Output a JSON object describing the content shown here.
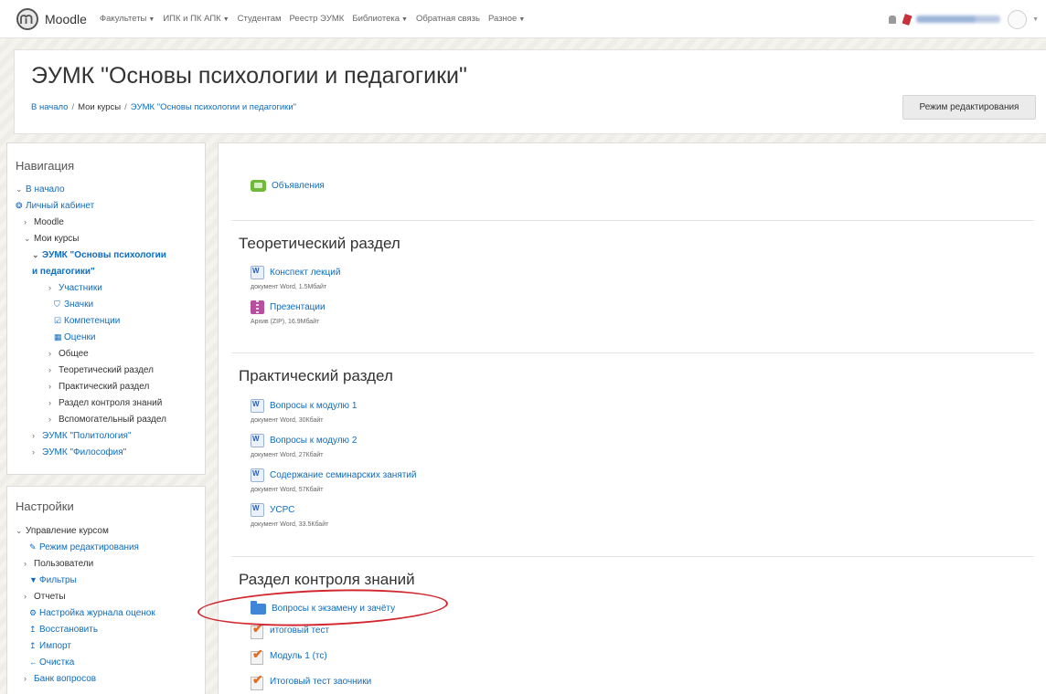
{
  "navbar": {
    "brand": "Moodle",
    "menu": [
      {
        "label": "Факультеты",
        "dropdown": true
      },
      {
        "label": "ИПК и ПК АПК",
        "dropdown": true
      },
      {
        "label": "Студентам",
        "dropdown": false
      },
      {
        "label": "Реестр ЭУМК",
        "dropdown": false
      },
      {
        "label": "Библиотека",
        "dropdown": true
      },
      {
        "label": "Обратная связь",
        "dropdown": false
      },
      {
        "label": "Разное",
        "dropdown": true
      }
    ],
    "caret": "▼"
  },
  "header": {
    "title": "ЭУМК \"Основы психологии и педагогики\"",
    "breadcrumb": [
      "В начало",
      "Мои курсы",
      "ЭУМК \"Основы психологии и педагогики\""
    ],
    "separator": "/",
    "edit_button": "Режим редактирования"
  },
  "navigation_block": {
    "title": "Навигация",
    "items": [
      {
        "label": "В начало",
        "icon": "chevron-down-icon",
        "glyph": "⌄"
      },
      {
        "label": "Личный кабинет",
        "icon": "dashboard-icon",
        "glyph": "❂"
      },
      {
        "label": "Moodle",
        "icon": "chevron-right-icon",
        "glyph": "›"
      },
      {
        "label": "Мои курсы",
        "icon": "chevron-down-icon",
        "glyph": "⌄"
      },
      {
        "label": "ЭУМК \"Основы психологии",
        "icon": "chevron-down-icon",
        "glyph": "⌄"
      },
      {
        "label": "и педагогики\""
      },
      {
        "label": "Участники",
        "icon": "chevron-right-icon",
        "glyph": "›"
      },
      {
        "label": "Значки",
        "icon": "shield-icon",
        "glyph": "⛉"
      },
      {
        "label": "Компетенции",
        "icon": "checkbox-icon",
        "glyph": "☑"
      },
      {
        "label": "Оценки",
        "icon": "table-icon",
        "glyph": "▦"
      },
      {
        "label": "Общее",
        "icon": "chevron-right-icon",
        "glyph": "›"
      },
      {
        "label": "Теоретический раздел",
        "icon": "chevron-right-icon",
        "glyph": "›"
      },
      {
        "label": "Практический раздел",
        "icon": "chevron-right-icon",
        "glyph": "›"
      },
      {
        "label": "Раздел контроля знаний",
        "icon": "chevron-right-icon",
        "glyph": "›"
      },
      {
        "label": "Вспомогательный раздел",
        "icon": "chevron-right-icon",
        "glyph": "›"
      },
      {
        "label": "ЭУМК \"Политология\"",
        "icon": "chevron-right-icon",
        "glyph": "›"
      },
      {
        "label": "ЭУМК \"Философия\"",
        "icon": "chevron-right-icon",
        "glyph": "›"
      }
    ]
  },
  "settings_block": {
    "title": "Настройки",
    "items": [
      {
        "label": "Управление курсом",
        "icon": "chevron-down-icon",
        "glyph": "⌄"
      },
      {
        "label": "Режим редактирования",
        "icon": "pencil-icon",
        "glyph": "✎"
      },
      {
        "label": "Пользователи",
        "icon": "chevron-right-icon",
        "glyph": "›"
      },
      {
        "label": "Фильтры",
        "icon": "filter-icon",
        "glyph": "▼"
      },
      {
        "label": "Отчеты",
        "icon": "chevron-right-icon",
        "glyph": "›"
      },
      {
        "label": "Настройка журнала оценок",
        "icon": "gear-icon",
        "glyph": "⚙"
      },
      {
        "label": "Восстановить",
        "icon": "upload-icon",
        "glyph": "↥"
      },
      {
        "label": "Импорт",
        "icon": "upload-icon",
        "glyph": "↥"
      },
      {
        "label": "Очистка",
        "icon": "arrow-left-icon",
        "glyph": "←"
      },
      {
        "label": "Банк вопросов",
        "icon": "chevron-right-icon",
        "glyph": "›"
      }
    ]
  },
  "course": {
    "announcements": "Объявления",
    "sections": [
      {
        "title": "Теоретический раздел",
        "activities": [
          {
            "label": "Конспект лекций",
            "icon": "word-document-icon",
            "meta": "документ Word, 1.5Мбайт"
          },
          {
            "label": "Презентации",
            "icon": "zip-archive-icon",
            "meta": "Архив (ZIP), 16.9Мбайт"
          }
        ]
      },
      {
        "title": "Практический раздел",
        "activities": [
          {
            "label": "Вопросы к модулю 1",
            "icon": "word-document-icon",
            "meta": "документ Word, 30Кбайт"
          },
          {
            "label": "Вопросы к модулю 2",
            "icon": "word-document-icon",
            "meta": "документ Word, 27Кбайт"
          },
          {
            "label": "Содержание семинарских занятий",
            "icon": "word-document-icon",
            "meta": "документ Word, 57Кбайт"
          },
          {
            "label": "УСРС",
            "icon": "word-document-icon",
            "meta": "документ Word, 33.5Кбайт"
          }
        ]
      },
      {
        "title": "Раздел контроля знаний",
        "activities": [
          {
            "label": "Вопросы к экзамену и зачёту",
            "icon": "folder-icon"
          },
          {
            "label": "итоговый тест",
            "icon": "quiz-icon"
          },
          {
            "label": "Модуль 1 (тс)",
            "icon": "quiz-icon"
          },
          {
            "label": "Итоговый тест заочники",
            "icon": "quiz-icon"
          }
        ]
      }
    ]
  },
  "colors": {
    "link": "#0f6cbf",
    "annotation": "#d2262e",
    "quiz_check": "#e46b1f",
    "folder": "#3f86d8"
  }
}
